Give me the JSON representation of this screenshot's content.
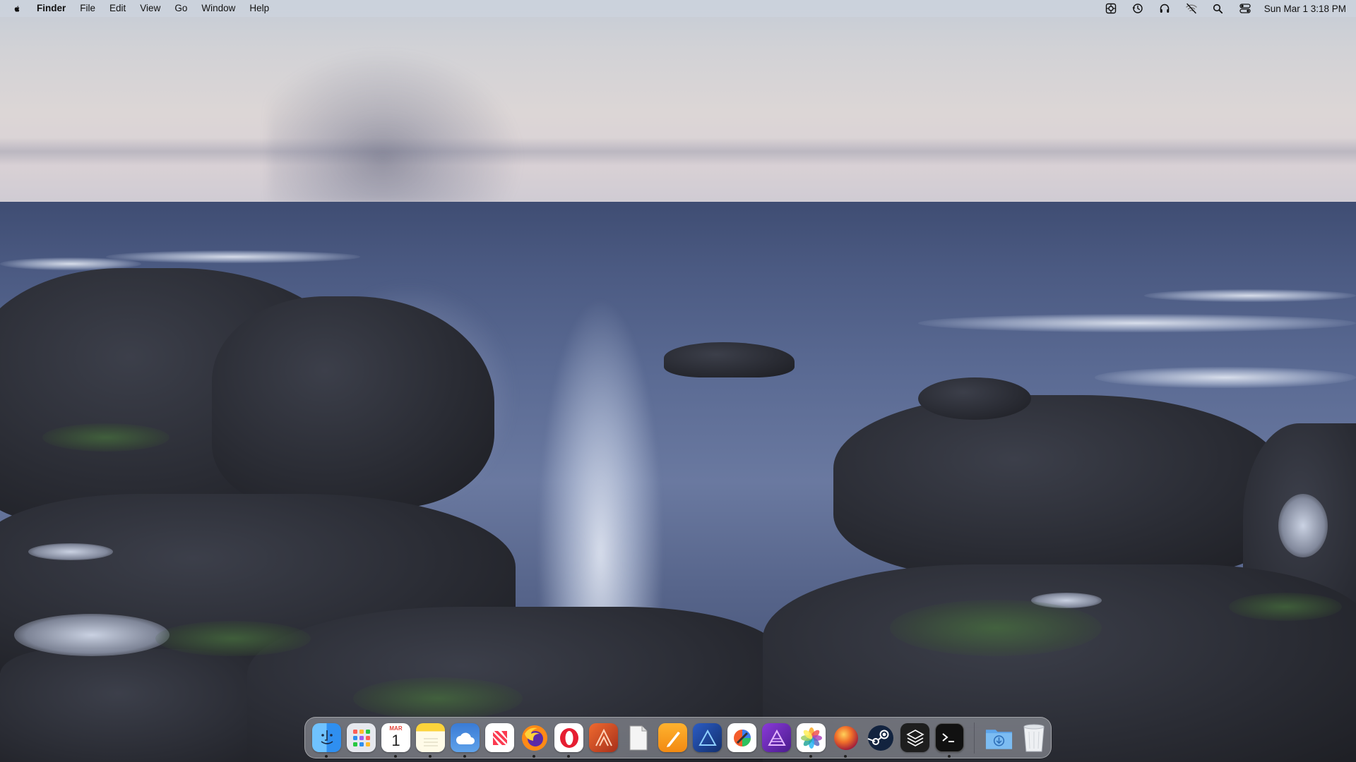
{
  "menubar": {
    "app_name": "Finder",
    "menus": [
      "File",
      "Edit",
      "View",
      "Go",
      "Window",
      "Help"
    ],
    "status_icons": [
      "screen-recording-icon",
      "time-machine-icon",
      "headphones-icon",
      "wifi-off-icon",
      "spotlight-search-icon",
      "control-center-icon"
    ],
    "clock": "Sun Mar 1  3:18 PM"
  },
  "dock": {
    "apps": [
      {
        "icon": "finder-icon",
        "running": true,
        "color": "#2f8ff0"
      },
      {
        "icon": "launchpad-icon",
        "running": false,
        "color": "#e8eaf0"
      },
      {
        "icon": "calendar-icon",
        "running": true,
        "color": "#ffffff",
        "month": "MAR",
        "day": "1"
      },
      {
        "icon": "notes-icon",
        "running": true,
        "color": "#fcd33b"
      },
      {
        "icon": "weather-icon",
        "running": true,
        "color": "#3a7bd5"
      },
      {
        "icon": "news-icon",
        "running": false,
        "color": "#ffffff"
      },
      {
        "icon": "firefox-icon",
        "running": true,
        "color": "#5b2aa8"
      },
      {
        "icon": "opera-icon",
        "running": true,
        "color": "#ffffff"
      },
      {
        "icon": "affinity-publisher-icon",
        "running": false,
        "color": "#c2441d"
      },
      {
        "icon": "textedit-icon",
        "running": false,
        "color": "#f2f2f2"
      },
      {
        "icon": "pages-icon",
        "running": false,
        "color": "#f59a1b"
      },
      {
        "icon": "affinity-designer-icon",
        "running": false,
        "color": "#1f3f8a"
      },
      {
        "icon": "pixelmator-icon",
        "running": false,
        "color": "#ffffff"
      },
      {
        "icon": "affinity-photo-icon",
        "running": false,
        "color": "#6b2fb0"
      },
      {
        "icon": "photos-icon",
        "running": true,
        "color": "#ffffff"
      },
      {
        "icon": "macos-installer-icon",
        "running": true,
        "color": "#e35a1c"
      },
      {
        "icon": "steam-icon",
        "running": false,
        "color": "#12233f"
      },
      {
        "icon": "sketch-app-icon",
        "running": false,
        "color": "#202020"
      },
      {
        "icon": "terminal-icon",
        "running": true,
        "color": "#111111"
      }
    ],
    "right": [
      {
        "icon": "downloads-folder-icon",
        "running": false,
        "color": "#79b4ef"
      },
      {
        "icon": "trash-icon",
        "running": false,
        "color": "#e9ecf0"
      }
    ]
  }
}
